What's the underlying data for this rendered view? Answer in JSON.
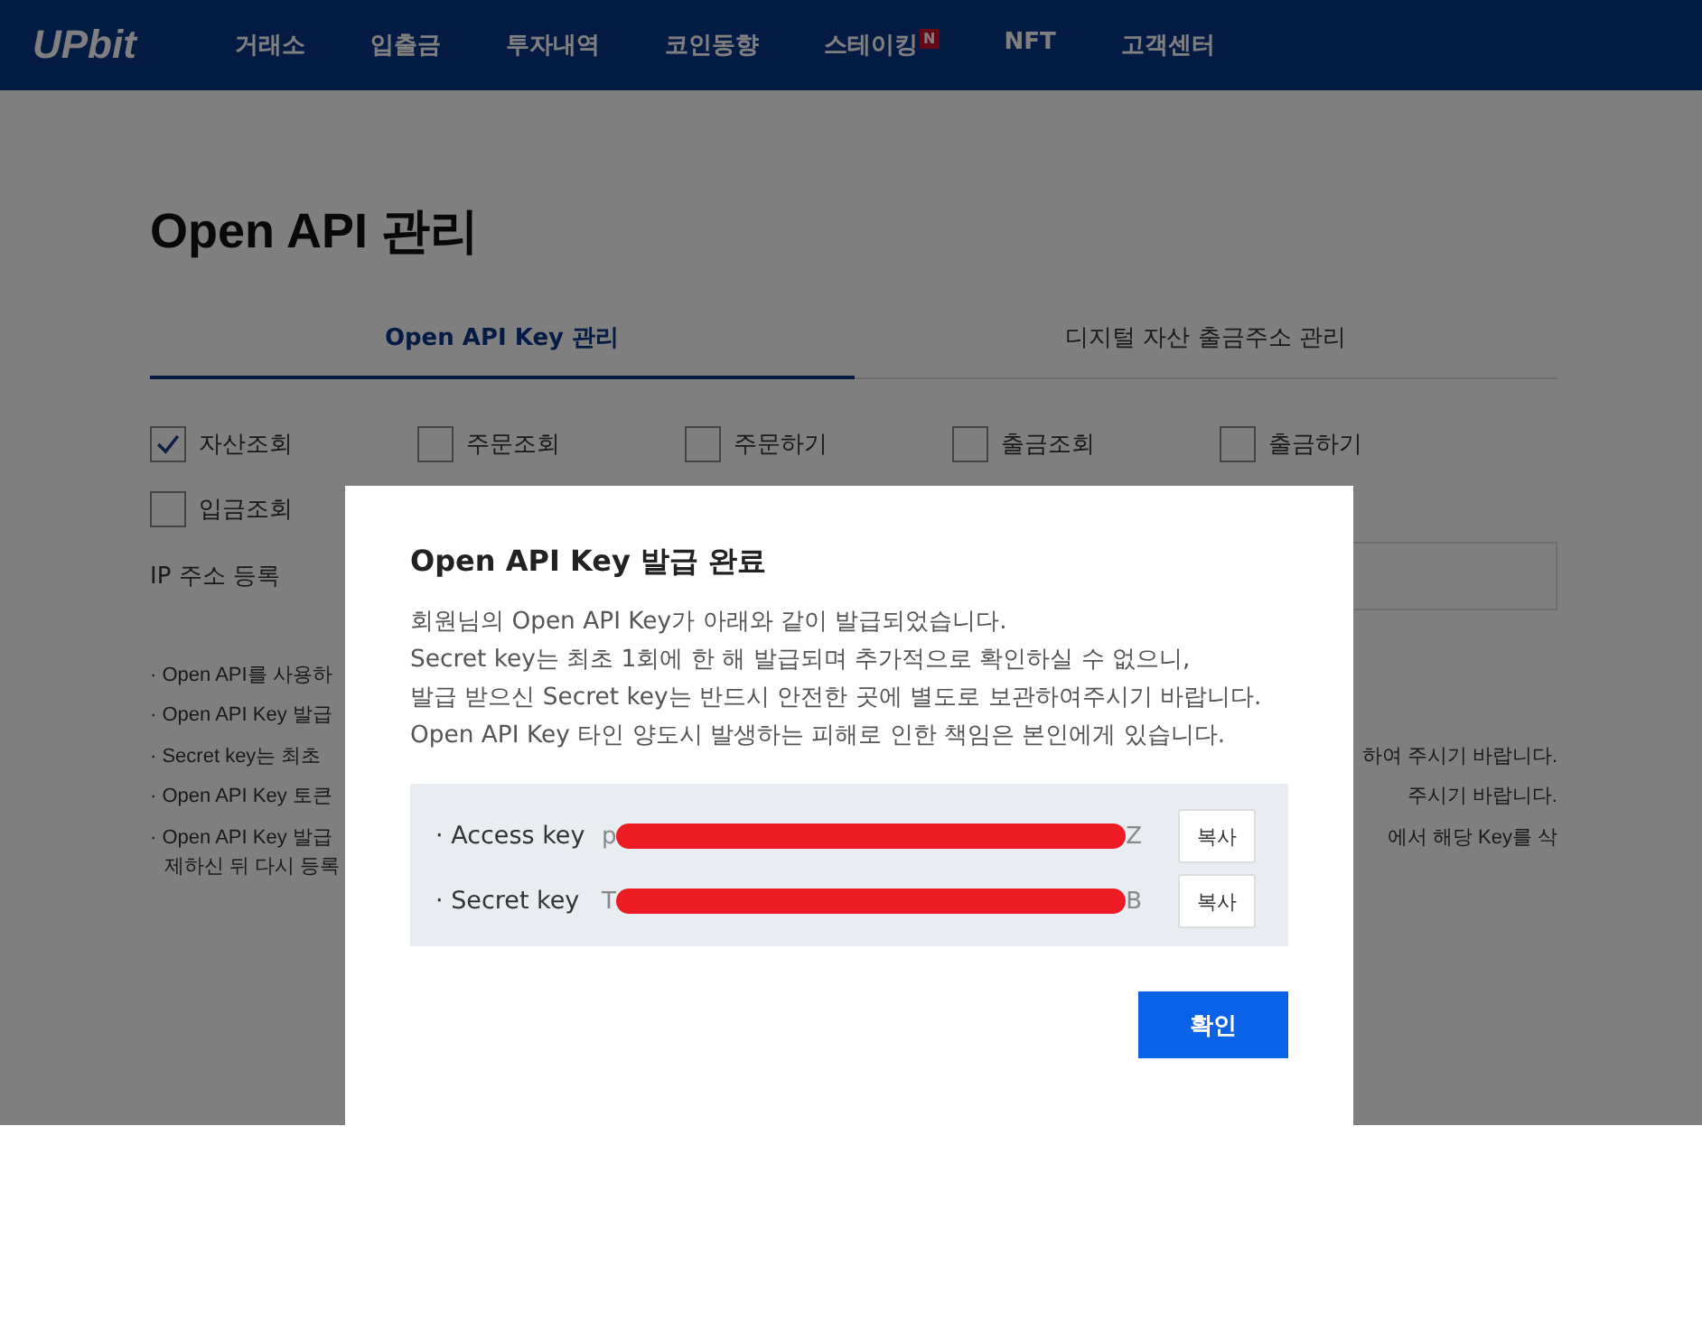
{
  "nav": {
    "logo": "UPbit",
    "items": [
      {
        "label": "거래소"
      },
      {
        "label": "입출금"
      },
      {
        "label": "투자내역"
      },
      {
        "label": "코인동향"
      },
      {
        "label": "스테이킹",
        "badge": "N"
      },
      {
        "label": "NFT"
      },
      {
        "label": "고객센터"
      }
    ]
  },
  "page": {
    "title": "Open API 관리",
    "tabs": [
      {
        "label": "Open API Key 관리",
        "selected": true
      },
      {
        "label": "디지털 자산 출금주소 관리",
        "selected": false
      }
    ],
    "permissions": [
      {
        "label": "자산조회",
        "checked": true
      },
      {
        "label": "주문조회",
        "checked": false
      },
      {
        "label": "주문하기",
        "checked": false
      },
      {
        "label": "출금조회",
        "checked": false
      },
      {
        "label": "출금하기",
        "checked": false
      },
      {
        "label": "입금조회",
        "checked": false
      }
    ],
    "ip_label": "IP 주소 등록",
    "notes": [
      {
        "left": "· Open API를 사용하"
      },
      {
        "left": "· Open API Key 발급"
      },
      {
        "left": "· Secret key는 최초",
        "right": "하여 주시기 바랍니다."
      },
      {
        "left": "· Open API Key 토큰",
        "right": "주시기 바랍니다."
      },
      {
        "left": "· Open API Key 발급",
        "right": "에서 해당 Key를 삭",
        "continuation": "제하신 뒤 다시 등록"
      }
    ]
  },
  "dialog": {
    "title": "Open API Key 발급 완료",
    "lines": [
      "회원님의 Open API Key가 아래와 같이 발급되었습니다.",
      "Secret key는 최초 1회에 한 해 발급되며 추가적으로 확인하실 수 없으니,",
      "발급 받으신 Secret key는 반드시 안전한 곳에 별도로 보관하여주시기 바랍니다.",
      "Open API Key 타인 양도시 발생하는 피해로 인한 책임은 본인에게 있습니다."
    ],
    "keys": [
      {
        "label": "· Access key",
        "head": "p",
        "tail": "Z",
        "copy": "복사"
      },
      {
        "label": "· Secret key",
        "head": "T",
        "tail": "B",
        "copy": "복사"
      }
    ],
    "confirm": "확인"
  }
}
